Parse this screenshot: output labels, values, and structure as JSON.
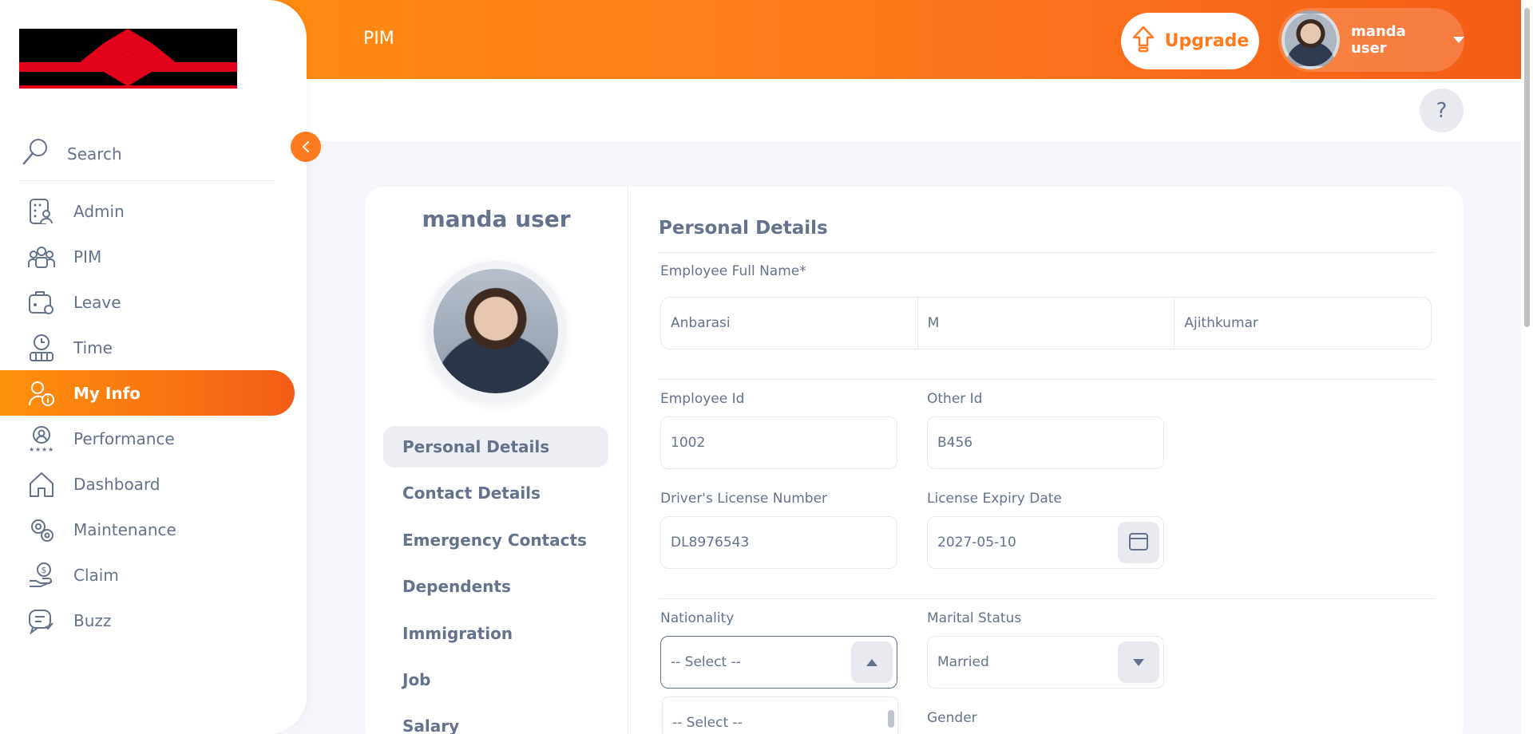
{
  "header": {
    "title": "PIM",
    "upgrade_label": "Upgrade",
    "user_name": "manda user",
    "help_label": "?"
  },
  "sidebar": {
    "search_label": "Search",
    "items": [
      {
        "label": "Admin",
        "icon": "admin-icon"
      },
      {
        "label": "PIM",
        "icon": "pim-icon"
      },
      {
        "label": "Leave",
        "icon": "leave-icon"
      },
      {
        "label": "Time",
        "icon": "time-icon"
      },
      {
        "label": "My Info",
        "icon": "my-info-icon",
        "active": true
      },
      {
        "label": "Performance",
        "icon": "performance-icon"
      },
      {
        "label": "Dashboard",
        "icon": "dashboard-icon"
      },
      {
        "label": "Maintenance",
        "icon": "maintenance-icon"
      },
      {
        "label": "Claim",
        "icon": "claim-icon"
      },
      {
        "label": "Buzz",
        "icon": "buzz-icon"
      }
    ]
  },
  "profile": {
    "name": "manda user",
    "tabs": [
      "Personal Details",
      "Contact Details",
      "Emergency Contacts",
      "Dependents",
      "Immigration",
      "Job",
      "Salary"
    ]
  },
  "form": {
    "section_title": "Personal Details",
    "full_name_label": "Employee Full Name*",
    "first_name": "Anbarasi",
    "middle_name": "M",
    "last_name": "Ajithkumar",
    "employee_id_label": "Employee Id",
    "employee_id": "1002",
    "other_id_label": "Other Id",
    "other_id": "B456",
    "license_label": "Driver's License Number",
    "license": "DL8976543",
    "expiry_label": "License Expiry Date",
    "expiry": "2027-05-10",
    "nationality_label": "Nationality",
    "nationality": "-- Select --",
    "nationality_option": "-- Select --",
    "marital_label": "Marital Status",
    "marital": "Married",
    "gender_label": "Gender"
  },
  "colors": {
    "accent": "#ff7b1d",
    "text": "#64728c"
  }
}
